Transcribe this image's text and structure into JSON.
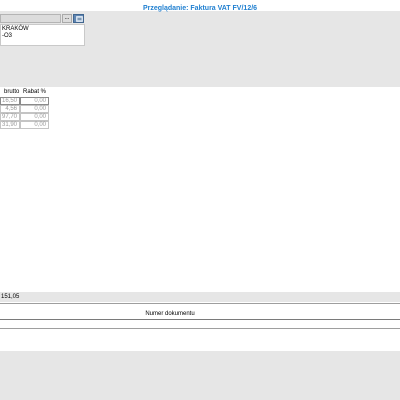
{
  "window": {
    "title": "Przeglądanie: Faktura VAT FV/12/6"
  },
  "contractor": {
    "ellipsis_label": "...",
    "browse_icon": "browse-icon",
    "address_line1": "KRAKÓW",
    "address_line2": "-O3"
  },
  "items_grid": {
    "columns": [
      "brutto",
      "Rabat %"
    ],
    "rows": [
      {
        "brutto": "16,50",
        "rabat": "0,00"
      },
      {
        "brutto": "4,56",
        "rabat": "0,00"
      },
      {
        "brutto": "97,70",
        "rabat": "0,00"
      },
      {
        "brutto": "31,90",
        "rabat": "0,00"
      }
    ]
  },
  "totals": {
    "value": "151,05"
  },
  "documents_table": {
    "column_header": "Numer dokumentu"
  },
  "colors": {
    "title": "#1f7fd0",
    "panel_bg": "#e6e6e6",
    "browse_button": "#5f86b3"
  }
}
